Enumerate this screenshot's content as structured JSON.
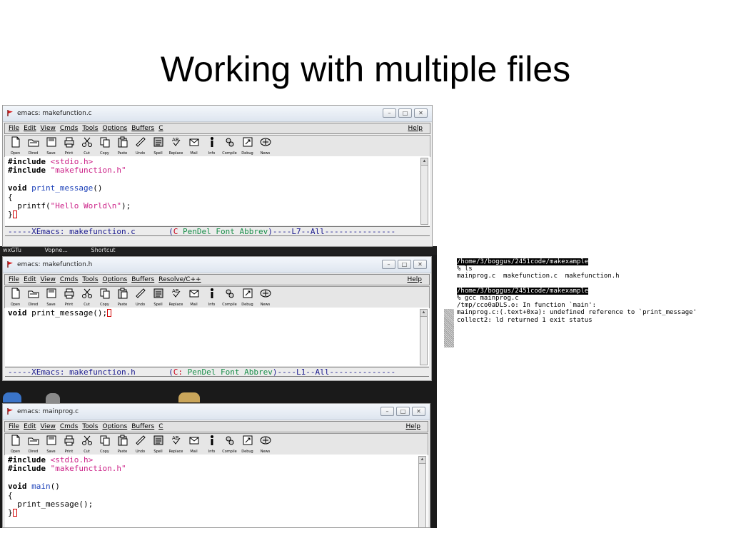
{
  "slide": {
    "title": "Working with multiple files"
  },
  "desktop": {
    "labels": [
      "wxGTu",
      "Vopne...",
      "Shortcut"
    ]
  },
  "menu": {
    "items": [
      "File",
      "Edit",
      "View",
      "Cmds",
      "Tools",
      "Options",
      "Buffers"
    ],
    "help": "Help"
  },
  "toolbar": {
    "buttons": [
      {
        "label": "Open",
        "icon": "open-file-icon"
      },
      {
        "label": "Dired",
        "icon": "dired-icon"
      },
      {
        "label": "Save",
        "icon": "save-icon"
      },
      {
        "label": "Print",
        "icon": "print-icon"
      },
      {
        "label": "Cut",
        "icon": "cut-icon"
      },
      {
        "label": "Copy",
        "icon": "copy-icon"
      },
      {
        "label": "Paste",
        "icon": "paste-icon"
      },
      {
        "label": "Undo",
        "icon": "undo-icon"
      },
      {
        "label": "Spell",
        "icon": "spell-icon"
      },
      {
        "label": "Replace",
        "icon": "replace-icon"
      },
      {
        "label": "Mail",
        "icon": "mail-icon"
      },
      {
        "label": "Info",
        "icon": "info-icon"
      },
      {
        "label": "Compile",
        "icon": "compile-icon"
      },
      {
        "label": "Debug",
        "icon": "debug-icon"
      },
      {
        "label": "News",
        "icon": "news-icon"
      }
    ]
  },
  "windows": {
    "w1": {
      "title": "emacs: makefunction.c",
      "extra_menu": "C",
      "lines": [
        [
          {
            "t": "#include ",
            "c": "kw"
          },
          {
            "t": "<stdio.h>",
            "c": "str"
          }
        ],
        [
          {
            "t": "#include ",
            "c": "kw"
          },
          {
            "t": "\"makefunction.h\"",
            "c": "str"
          }
        ],
        [],
        [
          {
            "t": "void ",
            "c": "kw"
          },
          {
            "t": "print_message",
            "c": "fn"
          },
          {
            "t": "()",
            "c": ""
          }
        ],
        [
          {
            "t": "{",
            "c": ""
          }
        ],
        [
          {
            "t": "  printf(",
            "c": ""
          },
          {
            "t": "\"Hello World\\n\"",
            "c": "str"
          },
          {
            "t": ");",
            "c": ""
          }
        ],
        [
          {
            "t": "}",
            "c": ""
          },
          {
            "t": "",
            "c": "cursor"
          }
        ]
      ],
      "modeline": [
        {
          "t": "-----XEmacs: makefunction.c       (",
          "c": ""
        },
        {
          "t": "C",
          "c": "mred"
        },
        {
          "t": " PenDel Font Abbrev",
          "c": "mgrn"
        },
        {
          "t": ")----L7--All---------------",
          "c": ""
        }
      ]
    },
    "w2": {
      "title": "emacs: makefunction.h",
      "extra_menu": "Resolve/C++",
      "lines": [
        [
          {
            "t": "void ",
            "c": "kw"
          },
          {
            "t": "print_message();",
            "c": ""
          },
          {
            "t": "",
            "c": "cursor"
          }
        ]
      ],
      "modeline": [
        {
          "t": "-----XEmacs: makefunction.h       (",
          "c": ""
        },
        {
          "t": "C:",
          "c": "mred"
        },
        {
          "t": " PenDel Font Abbrev",
          "c": "mgrn"
        },
        {
          "t": ")----L1--All--------------",
          "c": ""
        }
      ]
    },
    "w3": {
      "title": "emacs: mainprog.c",
      "extra_menu": "C",
      "lines": [
        [
          {
            "t": "#include ",
            "c": "kw"
          },
          {
            "t": "<stdio.h>",
            "c": "str"
          }
        ],
        [
          {
            "t": "#include ",
            "c": "kw"
          },
          {
            "t": "\"makefunction.h\"",
            "c": "str"
          }
        ],
        [],
        [
          {
            "t": "void ",
            "c": "kw"
          },
          {
            "t": "main",
            "c": "fn"
          },
          {
            "t": "()",
            "c": ""
          }
        ],
        [
          {
            "t": "{",
            "c": ""
          }
        ],
        [
          {
            "t": "  print_message();",
            "c": ""
          }
        ],
        [
          {
            "t": "}",
            "c": ""
          },
          {
            "t": "",
            "c": "cursor"
          }
        ]
      ]
    }
  },
  "terminal": {
    "lines": [
      {
        "t": "/home/3/boggus/2451code/makexample",
        "hl": true
      },
      {
        "t": "% ls",
        "hl": false
      },
      {
        "t": "mainprog.c  makefunction.c  makefunction.h",
        "hl": false
      },
      {
        "t": "",
        "hl": false
      },
      {
        "t": "/home/3/boggus/2451code/makexample",
        "hl": true
      },
      {
        "t": "% gcc mainprog.c",
        "hl": false
      },
      {
        "t": "/tmp/cco0aDLS.o: In function `main':",
        "hl": false
      },
      {
        "t": "mainprog.c:(.text+0xa): undefined reference to `print_message'",
        "hl": false
      },
      {
        "t": "collect2: ld returned 1 exit status",
        "hl": false
      }
    ]
  }
}
